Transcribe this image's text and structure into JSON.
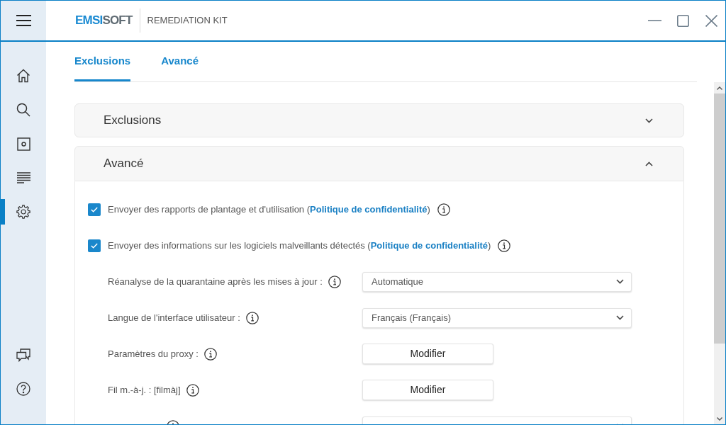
{
  "title_bar": {
    "logo": {
      "accent": "EMSI",
      "rest": "SOFT"
    },
    "product": "REMEDIATION KIT"
  },
  "sidebar": {
    "items": [
      {
        "kind": "home",
        "selected": false
      },
      {
        "kind": "search",
        "selected": false
      },
      {
        "kind": "square",
        "selected": false
      },
      {
        "kind": "lines",
        "selected": false
      },
      {
        "kind": "gear",
        "selected": true
      }
    ],
    "bottom_items": [
      {
        "kind": "chat",
        "selected": false
      },
      {
        "kind": "help",
        "selected": false
      }
    ]
  },
  "tabs": [
    {
      "label": "Exclusions",
      "selected": true
    },
    {
      "label": "Avancé",
      "selected": false
    }
  ],
  "sections": [
    {
      "title": "Exclusions",
      "expanded": false
    },
    {
      "title": "Avancé",
      "expanded": true,
      "rows": [
        {
          "kind": "checkbox",
          "checked": true,
          "text": "Envoyer des rapports de plantage et d'utilisation (",
          "link": "Politique de confidentialité",
          "after": ")"
        },
        {
          "kind": "checkbox",
          "checked": true,
          "text": "Envoyer des informations sur les logiciels malveillants détectés (",
          "link": "Politique de confidentialité",
          "after": ")"
        },
        {
          "kind": "select",
          "label": "Réanalyse de la quarantaine après les mises à jour :",
          "value": "Automatique"
        },
        {
          "kind": "select",
          "label": "Langue de l'interface utilisateur :",
          "value": "Français (Français)"
        },
        {
          "kind": "button",
          "label": "Paramètres du proxy :",
          "button": "Modifier"
        },
        {
          "kind": "button",
          "label": "Fil m.-à-j. : [filmàj]",
          "button": "Modifier"
        },
        {
          "kind": "select"
        }
      ]
    }
  ]
}
